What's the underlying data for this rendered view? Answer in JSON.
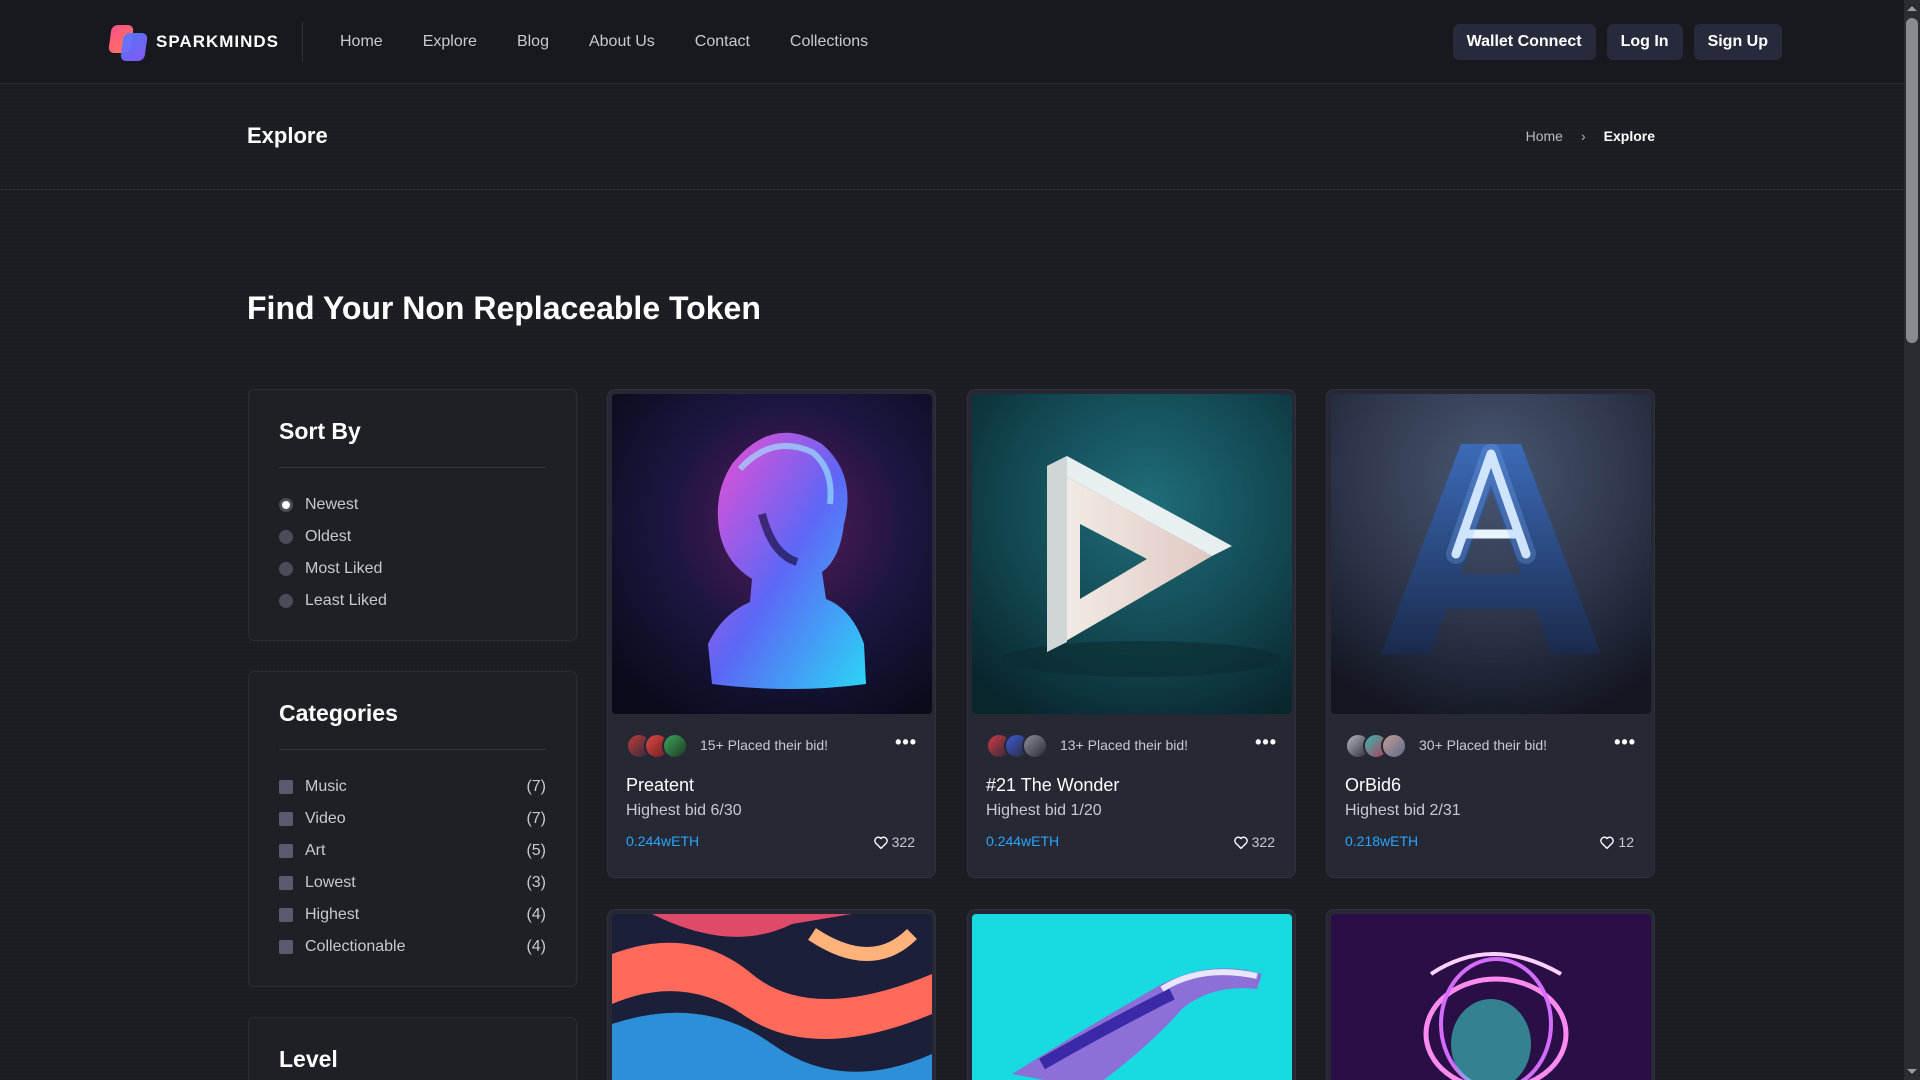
{
  "brand": {
    "name": "SPARKMINDS"
  },
  "nav": [
    "Home",
    "Explore",
    "Blog",
    "About Us",
    "Contact",
    "Collections"
  ],
  "header_buttons": {
    "wallet": "Wallet Connect",
    "login": "Log In",
    "signup": "Sign Up"
  },
  "page": {
    "title": "Explore",
    "breadcrumb_home": "Home",
    "breadcrumb_current": "Explore",
    "headline": "Find Your Non Replaceable Token"
  },
  "sort": {
    "title": "Sort By",
    "options": [
      "Newest",
      "Oldest",
      "Most Liked",
      "Least Liked"
    ],
    "selected": "Newest"
  },
  "categories": {
    "title": "Categories",
    "items": [
      {
        "label": "Music",
        "count": "(7)"
      },
      {
        "label": "Video",
        "count": "(7)"
      },
      {
        "label": "Art",
        "count": "(5)"
      },
      {
        "label": "Lowest",
        "count": "(3)"
      },
      {
        "label": "Highest",
        "count": "(4)"
      },
      {
        "label": "Collectionable",
        "count": "(4)"
      }
    ]
  },
  "level": {
    "title": "Level"
  },
  "cards": [
    {
      "name": "Preatent",
      "bids": "15+ Placed their bid!",
      "highest": "Highest bid 6/30",
      "price": "0.244wETH",
      "likes": "322"
    },
    {
      "name": "#21 The Wonder",
      "bids": "13+ Placed their bid!",
      "highest": "Highest bid 1/20",
      "price": "0.244wETH",
      "likes": "322"
    },
    {
      "name": "OrBid6",
      "bids": "30+ Placed their bid!",
      "highest": "Highest bid 2/31",
      "price": "0.218wETH",
      "likes": "12"
    }
  ],
  "colors": {
    "price": "#2aa6ff",
    "background": "#1c1d22",
    "card": "#262833",
    "button": "#262a3a"
  }
}
